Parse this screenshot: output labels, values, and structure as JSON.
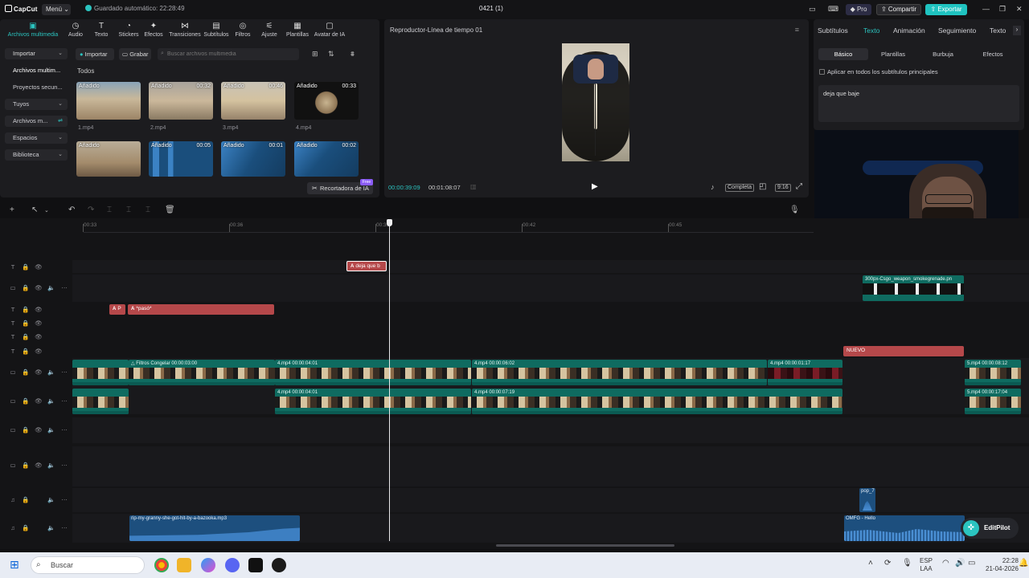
{
  "titlebar": {
    "app_name": "CapCut",
    "menu_label": "Menú",
    "autosave": "Guardado automático: 22:28:49",
    "project_title": "0421 (1)",
    "pro_label": "Pro",
    "share_label": "Compartir",
    "export_label": "Exportar"
  },
  "media_toolbar": {
    "tabs": [
      "Archivos multimedia",
      "Audio",
      "Texto",
      "Stickers",
      "Efectos",
      "Transiciones",
      "Subtítulos",
      "Filtros",
      "Ajuste",
      "Plantillas",
      "Avatar de IA"
    ]
  },
  "media_nav": {
    "items": [
      "Importar",
      "Archivos multim...",
      "Proyectos secun...",
      "Tuyos",
      "Archivos m...",
      "Espacios",
      "Biblioteca"
    ]
  },
  "media": {
    "import_label": "Importar",
    "record_label": "Grabar",
    "search_placeholder": "Buscar archivos multimedia",
    "section": "Todos",
    "items": [
      {
        "tag": "Añadido",
        "duration": "",
        "name": "1.mp4"
      },
      {
        "tag": "Añadido",
        "duration": "00:32",
        "name": "2.mp4"
      },
      {
        "tag": "Añadido",
        "duration": "00:46",
        "name": "3.mp4"
      },
      {
        "tag": "Añadido",
        "duration": "00:33",
        "name": "4.mp4"
      },
      {
        "tag": "Añadido",
        "duration": "",
        "name": ""
      },
      {
        "tag": "Añadido",
        "duration": "00:05",
        "name": ""
      },
      {
        "tag": "Añadido",
        "duration": "00:01",
        "name": ""
      },
      {
        "tag": "Añadido",
        "duration": "00:02",
        "name": ""
      }
    ],
    "ai_button": "Recortadora de IA",
    "free_badge": "Free"
  },
  "player": {
    "title": "Reproductor-Línea de tiempo 01",
    "current_time": "00:00:39:09",
    "total_time": "00:01:08:07",
    "zoom_label": "Completa",
    "ratio_label": "9:16"
  },
  "right_panel": {
    "tabs": [
      "Subtítulos",
      "Texto",
      "Animación",
      "Seguimiento",
      "Texto"
    ],
    "subtabs": [
      "Básico",
      "Plantillas",
      "Burbuja",
      "Efectos"
    ],
    "apply_all": "Aplicar en todos los subtítulos principales",
    "text_value": "deja que baje"
  },
  "timeline": {
    "ruler": [
      "00:33",
      "00:36",
      "00:39",
      "00:42",
      "00:45"
    ],
    "clips": {
      "text_top": "deja que b",
      "text_a": "P",
      "text_b": "*pasó*",
      "label_nuevo": "NUEVO",
      "sticker_clip": "300px-Csgo_weapon_smokegrenade.pn",
      "v1_filter": "Filtros",
      "v1_freeze": "Congelar",
      "v1_freeze_time": "00:00:03:00",
      "v1_a_name": "4.mp4",
      "v1_a_time": "00:00:04:01",
      "v1_b_name": "4.mp4",
      "v1_b_time": "00:00:06:02",
      "v1_c_name": "4.mp4",
      "v1_c_time": "00:00:01:17",
      "v1_d_name": "5.mp4",
      "v1_d_time": "00:00:08:12",
      "v2_a_name": "4.mp4",
      "v2_a_time": "00:00:04:01",
      "v2_b_name": "4.mp4",
      "v2_b_time": "00:00:07:19",
      "v2_c_name": "5.mp4",
      "v2_c_time": "00:00:17:04",
      "audio_a": "rip-my-granny-she-got-hit-by-a-bazooka.mp3",
      "audio_b": "pop_7",
      "audio_c": "OMFG - Hello"
    },
    "editpilot": "EditPilot"
  },
  "taskbar": {
    "search_placeholder": "Buscar",
    "lang_top": "ESP",
    "lang_bottom": "LAA",
    "time": "22:28",
    "date": "21-04-2026"
  },
  "colors": {
    "accent": "#2bc4c0",
    "text_clip": "#b5484a",
    "video_clip": "#0f6b60",
    "audio_clip": "#1d4f7e"
  }
}
